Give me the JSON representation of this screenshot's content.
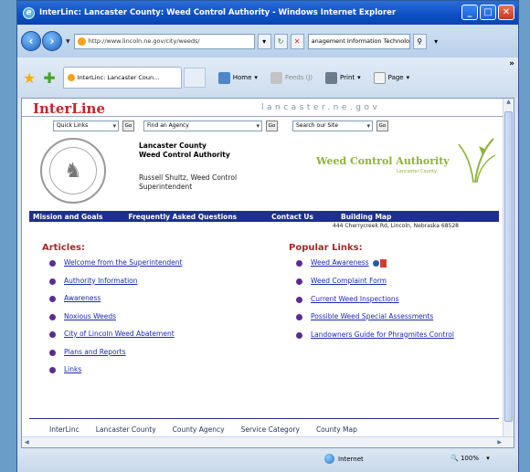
{
  "window": {
    "title": "InterLinc: Lancaster County: Weed Control Authority - Windows Internet Explorer"
  },
  "address_bar": {
    "url": "http://www.lincoln.ne.gov/city/weeds/",
    "search_text": "anagement Information Technologies"
  },
  "toolbar": {
    "tab_label": "InterLinc: Lancaster Coun...",
    "home": "Home",
    "feeds": "Feeds (J)",
    "print": "Print",
    "page": "Page"
  },
  "page": {
    "logo": "InterLine",
    "site_name": "lancaster.ne.gov",
    "quick_links": "Quick Links",
    "find_agency": "Find an Agency",
    "search_site": "Search our Site",
    "go": "Go",
    "org_line1": "Lancaster County",
    "org_line2": "Weed Control Authority",
    "contact_line1": "Russell Shultz, Weed Control",
    "contact_line2": "Superintendent",
    "wca_logo": "Weed Control Authority",
    "wca_sub": "Lancaster County",
    "seal_text": "SEAL OF LANCASTER COUNTY NEBRASKA",
    "nav": [
      "Mission and Goals",
      "Frequently Asked Questions",
      "Contact Us",
      "Building Map"
    ],
    "address": "444 Cherrycreek Rd, Lincoln, Nebraska 68528",
    "articles_title": "Articles:",
    "articles": [
      "Welcome from the Superintendent",
      "Authority Information",
      "Awareness",
      "Noxious Weeds",
      "City of Lincoln Weed Abatement",
      "Plans and Reports",
      "Links"
    ],
    "popular_title": "Popular Links:",
    "popular": [
      "Weed Awareness",
      "Weed Complaint Form",
      "Current Weed Inspections",
      "Possible Weed Special Assessments",
      "Landowners Guide for Phragmites Control"
    ],
    "footer": [
      "InterLinc",
      "Lancaster County",
      "County Agency",
      "Service Category",
      "County Map"
    ]
  },
  "status": {
    "zone": "Internet",
    "zoom": "100%"
  },
  "colors": {
    "titlebar": "#0b4fc4",
    "navbar": "#1f2f8f",
    "heading_red": "#a02b28",
    "link_blue": "#1a2bb0",
    "bullet_purple": "#5c2c91",
    "wca_green": "#8cb33a"
  }
}
